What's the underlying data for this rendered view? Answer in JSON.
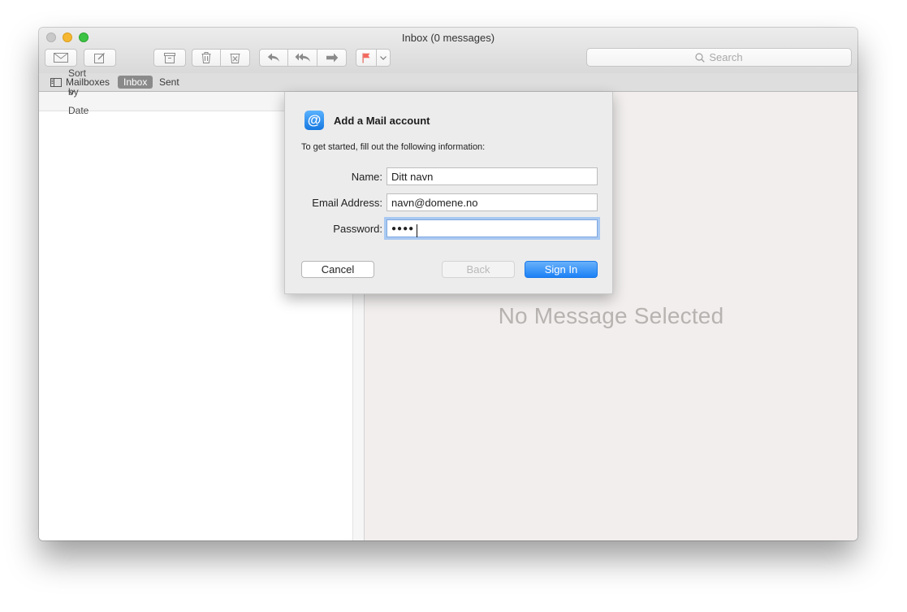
{
  "window": {
    "title": "Inbox (0 messages)"
  },
  "toolbar": {
    "buttons": [
      "get-mail",
      "compose",
      "archive",
      "delete",
      "junk",
      "reply",
      "reply-all",
      "forward",
      "flag",
      "flag-menu"
    ],
    "search_placeholder": "Search"
  },
  "favorites": {
    "mailboxes": "Mailboxes",
    "inbox": "Inbox",
    "sent": "Sent"
  },
  "list": {
    "sort_label": "Sort by Date"
  },
  "viewer": {
    "empty_text": "No Message Selected"
  },
  "dialog": {
    "title": "Add a Mail account",
    "description": "To get started, fill out the following information:",
    "fields": {
      "name_label": "Name:",
      "name_value": "Ditt navn",
      "email_label": "Email Address:",
      "email_value": "navn@domene.no",
      "password_label": "Password:",
      "password_value": "●●●●"
    },
    "buttons": {
      "cancel": "Cancel",
      "back": "Back",
      "sign_in": "Sign In"
    }
  },
  "colors": {
    "accent": "#1c81f6",
    "flag": "#f26a5f",
    "close": "#c9c9c9",
    "minimize": "#f5b731",
    "zoom": "#3cc343"
  }
}
